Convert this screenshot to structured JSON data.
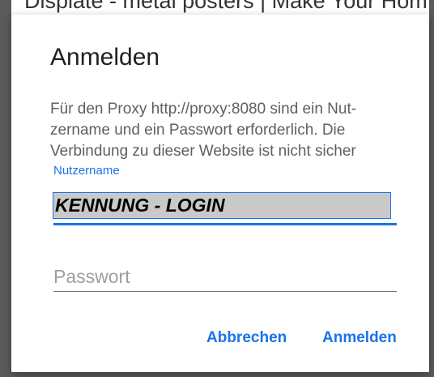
{
  "background": {
    "page_title": "Displate - metal posters | Make Your Hom"
  },
  "dialog": {
    "title": "Anmelden",
    "message": "Für den Proxy http://proxy:8080 sind ein Nut­zername und ein Passwort erforderlich. Die Verbindung zu dieser Website ist nicht sicher",
    "username": {
      "label": "Nutzername",
      "value": "KENNUNG - LOGIN"
    },
    "password": {
      "placeholder": "Passwort",
      "value": ""
    },
    "buttons": {
      "cancel": "Abbrechen",
      "login": "Anmelden"
    }
  },
  "colors": {
    "accent": "#1a73e8",
    "scrim": "#5c5c5c"
  }
}
